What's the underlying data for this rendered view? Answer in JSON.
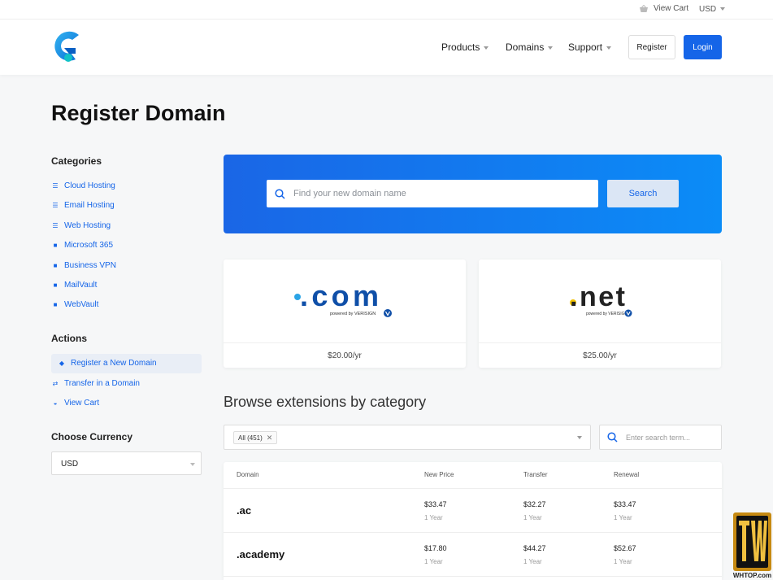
{
  "topbar": {
    "view_cart": "View Cart",
    "currency": "USD"
  },
  "nav": {
    "products": "Products",
    "domains": "Domains",
    "support": "Support",
    "register": "Register",
    "login": "Login"
  },
  "page_title": "Register Domain",
  "sidebar": {
    "categories_heading": "Categories",
    "categories": [
      "Cloud Hosting",
      "Email Hosting",
      "Web Hosting",
      "Microsoft 365",
      "Business VPN",
      "MailVault",
      "WebVault"
    ],
    "actions_heading": "Actions",
    "actions": [
      "Register a New Domain",
      "Transfer in a Domain",
      "View Cart"
    ],
    "currency_heading": "Choose Currency",
    "currency_value": "USD"
  },
  "search": {
    "placeholder": "Find your new domain name",
    "button": "Search"
  },
  "featured": [
    {
      "tld": ".com",
      "powered": "powered by VERISIGN",
      "price": "$20.00/yr"
    },
    {
      "tld": ".net",
      "powered": "powered by VERISIGN",
      "price": "$25.00/yr"
    }
  ],
  "browse_heading": "Browse extensions by category",
  "filter": {
    "chip": "All (451)",
    "term_placeholder": "Enter search term..."
  },
  "table": {
    "headers": [
      "Domain",
      "New Price",
      "Transfer",
      "Renewal"
    ],
    "rows": [
      {
        "domain": ".ac",
        "new_price": "$33.47",
        "new_term": "1 Year",
        "transfer": "$32.27",
        "transfer_term": "1 Year",
        "renewal": "$33.47",
        "renewal_term": "1 Year"
      },
      {
        "domain": ".academy",
        "new_price": "$17.80",
        "new_term": "1 Year",
        "transfer": "$44.27",
        "transfer_term": "1 Year",
        "renewal": "$52.67",
        "renewal_term": "1 Year"
      }
    ]
  },
  "colors": {
    "primary": "#1565e8",
    "hero_start": "#1a66e6",
    "hero_end": "#0b8cf7",
    "com_dot": "#2aa4e6",
    "net_dot": "#f2c200"
  },
  "watermark": {
    "text": "WHTOP.com"
  }
}
